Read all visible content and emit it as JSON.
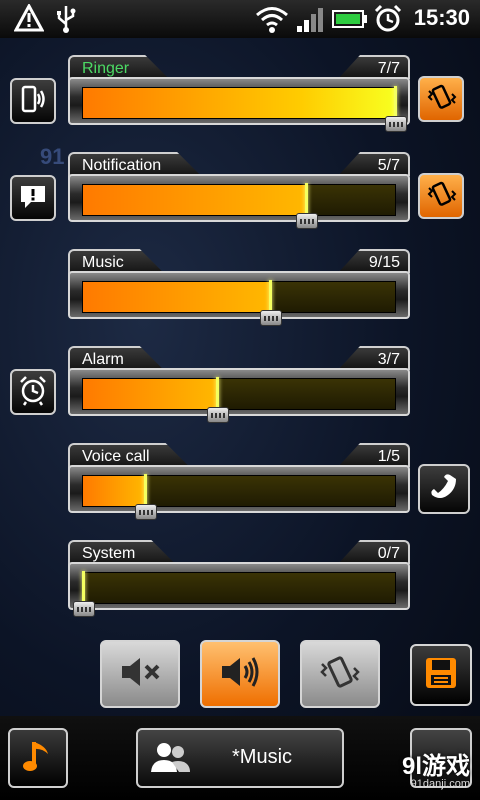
{
  "status_bar": {
    "time": "15:30",
    "icons": [
      "warning-icon",
      "usb-icon",
      "wifi-icon",
      "signal-icon",
      "battery-icon",
      "alarm-clock-icon"
    ]
  },
  "sliders": [
    {
      "label": "Ringer",
      "value_text": "7/7",
      "level": 1.0,
      "label_color": "#4cd964"
    },
    {
      "label": "Notification",
      "value_text": "5/7",
      "level": 0.714
    },
    {
      "label": "Music",
      "value_text": "9/15",
      "level": 0.6
    },
    {
      "label": "Alarm",
      "value_text": "3/7",
      "level": 0.428
    },
    {
      "label": "Voice call",
      "value_text": "1/5",
      "level": 0.2
    },
    {
      "label": "System",
      "value_text": "0/7",
      "level": 0.0
    }
  ],
  "side_icons": {
    "left": [
      "ringer-icon",
      "notification-icon",
      "alarm-icon"
    ],
    "right": [
      "vibrate-icon",
      "vibrate-icon",
      "phone-icon"
    ]
  },
  "mode_buttons": [
    "mute-icon",
    "sound-icon",
    "vibrate-icon"
  ],
  "save_button": "save-icon",
  "bottom": {
    "profile_label": "*Music",
    "profile_icon": "people-icon",
    "music_icon": "music-note-icon"
  },
  "watermark": {
    "text": "9l游戏",
    "sub": "91danji.com",
    "faint": "91"
  },
  "colors": {
    "accent_orange": "#ff8a00",
    "ringer_label": "#4cd964"
  }
}
